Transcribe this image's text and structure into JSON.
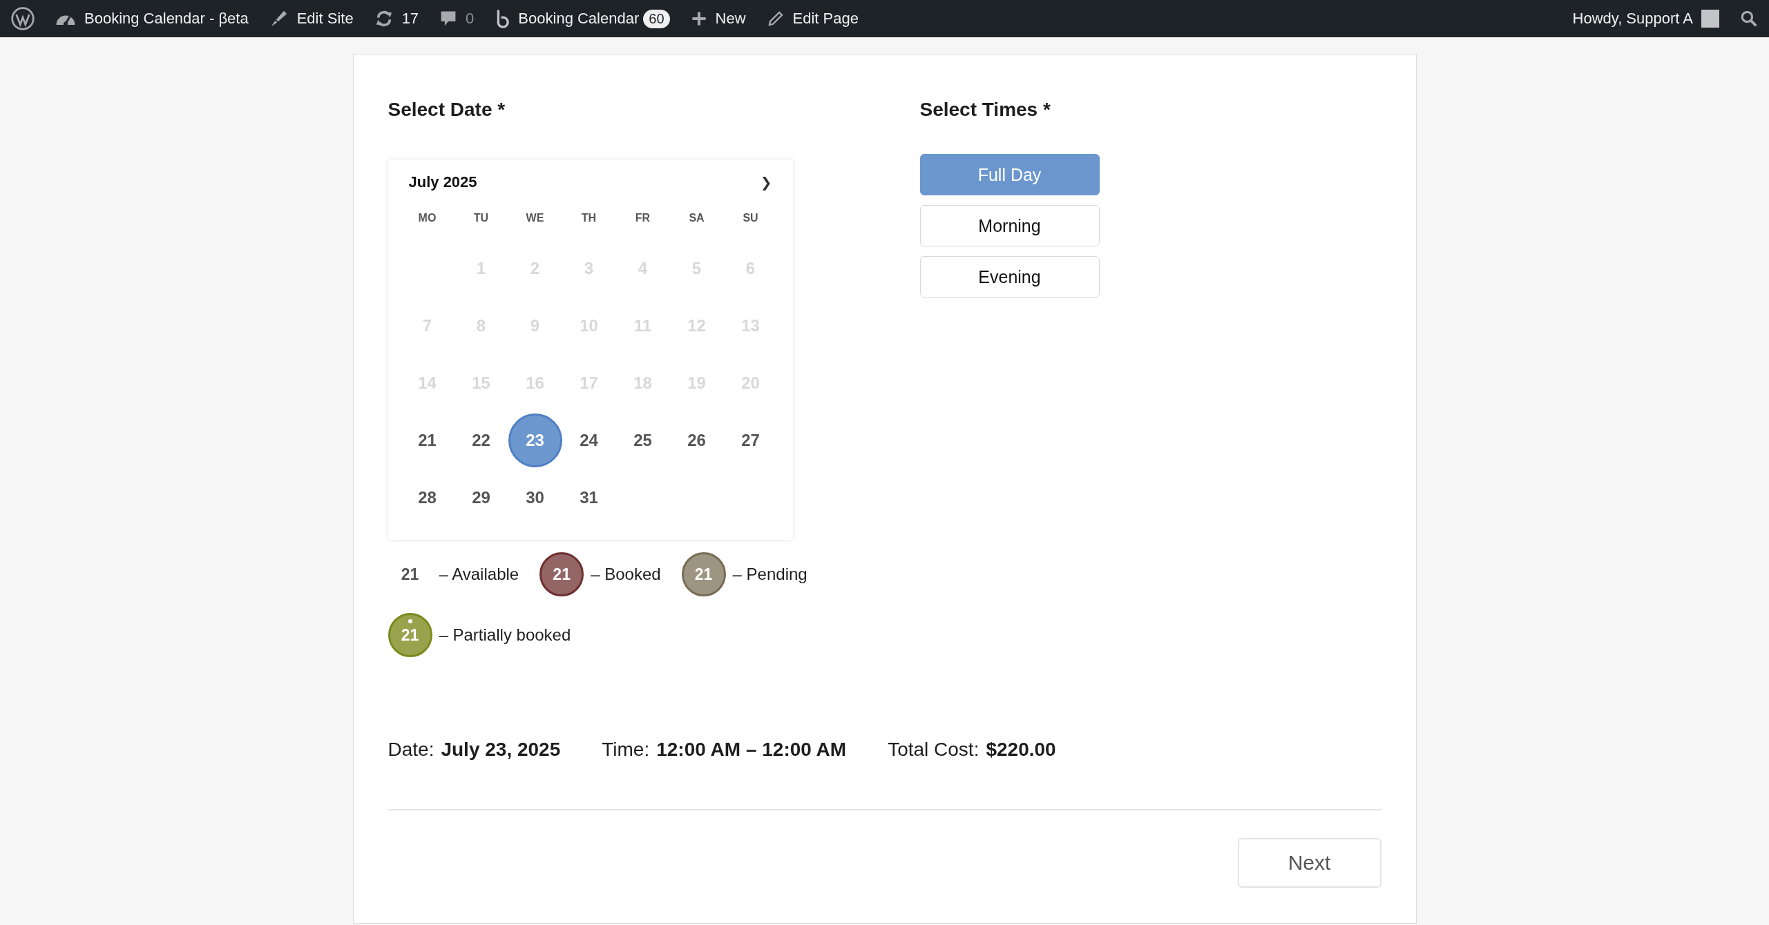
{
  "admin_bar": {
    "items": [
      {
        "kind": "wp"
      },
      {
        "kind": "dashboard",
        "label": "Booking Calendar - βeta"
      },
      {
        "kind": "brush",
        "label": "Edit Site"
      },
      {
        "kind": "updates",
        "label": "17"
      },
      {
        "kind": "comments",
        "label": "0"
      },
      {
        "kind": "booking",
        "label": "Booking Calendar",
        "badge": "60"
      },
      {
        "kind": "new",
        "label": "New"
      },
      {
        "kind": "edit",
        "label": "Edit Page"
      }
    ],
    "greeting": "Howdy, Support A"
  },
  "date_section": {
    "title": "Select Date *",
    "calendar": {
      "month": "July 2025",
      "next": "❯",
      "weekdays": [
        "MO",
        "TU",
        "WE",
        "TH",
        "FR",
        "SA",
        "SU"
      ],
      "weeks": [
        [
          {
            "kind": "blank"
          },
          {
            "kind": "day",
            "label": "1",
            "disabled": true,
            "selected": false
          },
          {
            "kind": "day",
            "label": "2",
            "disabled": true,
            "selected": false
          },
          {
            "kind": "day",
            "label": "3",
            "disabled": true,
            "selected": false
          },
          {
            "kind": "day",
            "label": "4",
            "disabled": true,
            "selected": false
          },
          {
            "kind": "day",
            "label": "5",
            "disabled": true,
            "selected": false
          },
          {
            "kind": "day",
            "label": "6",
            "disabled": true,
            "selected": false
          }
        ],
        [
          {
            "kind": "day",
            "label": "7",
            "disabled": true,
            "selected": false
          },
          {
            "kind": "day",
            "label": "8",
            "disabled": true,
            "selected": false
          },
          {
            "kind": "day",
            "label": "9",
            "disabled": true,
            "selected": false
          },
          {
            "kind": "day",
            "label": "10",
            "disabled": true,
            "selected": false
          },
          {
            "kind": "day",
            "label": "11",
            "disabled": true,
            "selected": false
          },
          {
            "kind": "day",
            "label": "12",
            "disabled": true,
            "selected": false
          },
          {
            "kind": "day",
            "label": "13",
            "disabled": true,
            "selected": false
          }
        ],
        [
          {
            "kind": "day",
            "label": "14",
            "disabled": true,
            "selected": false
          },
          {
            "kind": "day",
            "label": "15",
            "disabled": true,
            "selected": false
          },
          {
            "kind": "day",
            "label": "16",
            "disabled": true,
            "selected": false
          },
          {
            "kind": "day",
            "label": "17",
            "disabled": true,
            "selected": false
          },
          {
            "kind": "day",
            "label": "18",
            "disabled": true,
            "selected": false
          },
          {
            "kind": "day",
            "label": "19",
            "disabled": true,
            "selected": false
          },
          {
            "kind": "day",
            "label": "20",
            "disabled": true,
            "selected": false
          }
        ],
        [
          {
            "kind": "day",
            "label": "21",
            "disabled": false,
            "selected": false
          },
          {
            "kind": "day",
            "label": "22",
            "disabled": false,
            "selected": false
          },
          {
            "kind": "day",
            "label": "23",
            "disabled": false,
            "selected": true
          },
          {
            "kind": "day",
            "label": "24",
            "disabled": false,
            "selected": false
          },
          {
            "kind": "day",
            "label": "25",
            "disabled": false,
            "selected": false
          },
          {
            "kind": "day",
            "label": "26",
            "disabled": false,
            "selected": false
          },
          {
            "kind": "day",
            "label": "27",
            "disabled": false,
            "selected": false
          }
        ],
        [
          {
            "kind": "day",
            "label": "28",
            "disabled": false,
            "selected": false
          },
          {
            "kind": "day",
            "label": "29",
            "disabled": false,
            "selected": false
          },
          {
            "kind": "day",
            "label": "30",
            "disabled": false,
            "selected": false
          },
          {
            "kind": "day",
            "label": "31",
            "disabled": false,
            "selected": false
          },
          {
            "kind": "blank"
          },
          {
            "kind": "blank"
          },
          {
            "kind": "blank"
          }
        ]
      ]
    },
    "legend": [
      {
        "kind": "available",
        "day": "21",
        "label": "– Available"
      },
      {
        "kind": "booked",
        "day": "21",
        "label": "– Booked",
        "color": "#946565"
      },
      {
        "kind": "pending",
        "day": "21",
        "label": "– Pending",
        "color": "#9e9482"
      },
      {
        "kind": "partial",
        "day": "21",
        "label": "– Partially booked",
        "color": "#98a34d"
      }
    ]
  },
  "times_section": {
    "title": "Select Times *",
    "options": [
      {
        "label": "Full Day",
        "selected": true
      },
      {
        "label": "Morning",
        "selected": false
      },
      {
        "label": "Evening",
        "selected": false
      }
    ]
  },
  "summary": [
    {
      "label": "Date:",
      "value": "July 23, 2025"
    },
    {
      "label": "Time:",
      "value": "12:00 AM – 12:00 AM"
    },
    {
      "label": "Total Cost:",
      "value": "$220.00"
    }
  ],
  "next_button": "Next"
}
